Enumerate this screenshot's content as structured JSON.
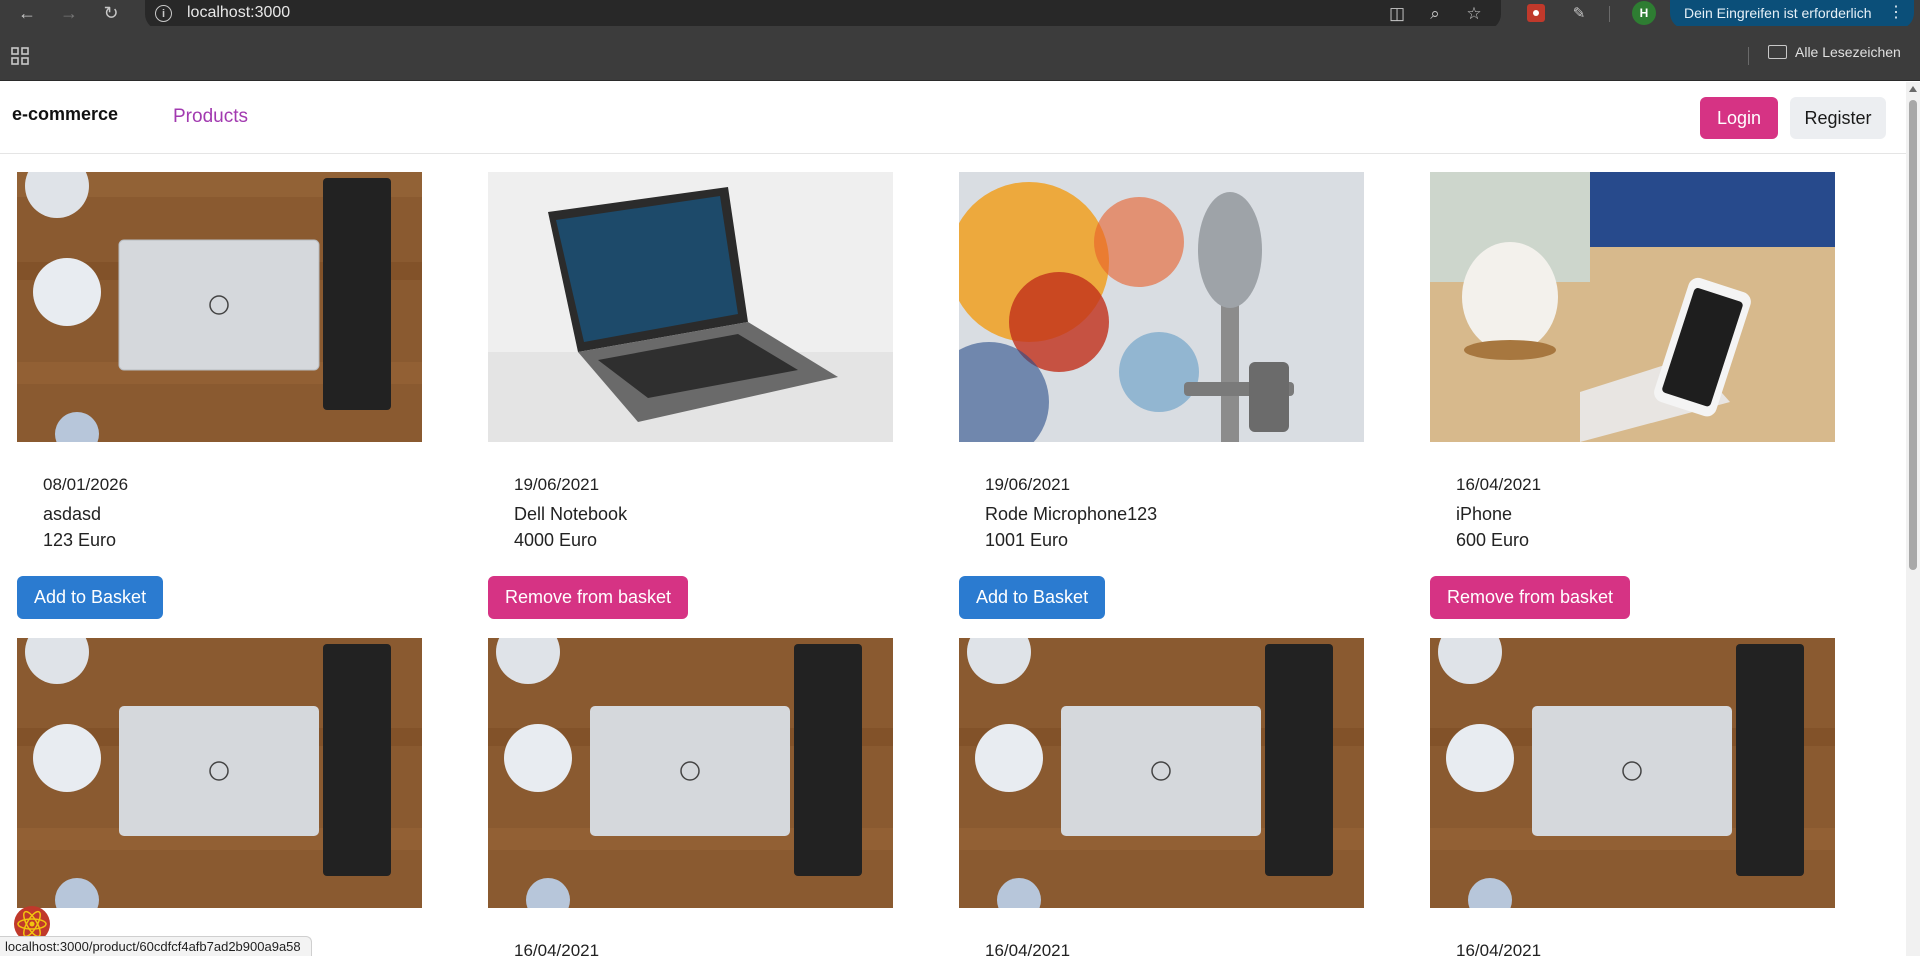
{
  "browser": {
    "url": "localhost:3000",
    "update_notice": "Dein Eingreifen ist erforderlich",
    "profile_initial": "H",
    "bookmarks_all": "Alle Lesezeichen",
    "status_url": "localhost:3000/product/60cdfcf4afb7ad2b900a9a58"
  },
  "navbar": {
    "brand": "e-commerce",
    "products_link": "Products",
    "login": "Login",
    "register": "Register"
  },
  "products": [
    {
      "date": "08/01/2026",
      "name": "asdasd",
      "price": "123 Euro",
      "button": "Add to Basket",
      "button_color": "#2b7bd0",
      "image": "laptop-desk"
    },
    {
      "date": "19/06/2021",
      "name": "Dell Notebook",
      "price": "4000 Euro",
      "button": "Remove from basket",
      "button_color": "#d63384",
      "image": "laptop-open"
    },
    {
      "date": "19/06/2021",
      "name": "Rode Microphone123",
      "price": "1001 Euro",
      "button": "Add to Basket",
      "button_color": "#2b7bd0",
      "image": "microphone"
    },
    {
      "date": "16/04/2021",
      "name": "iPhone",
      "price": "600 Euro",
      "button": "Remove from basket",
      "button_color": "#d63384",
      "image": "phone-hand"
    },
    {
      "date": "",
      "image": "laptop-desk"
    },
    {
      "date": "16/04/2021",
      "image": "laptop-desk"
    },
    {
      "date": "16/04/2021",
      "image": "laptop-desk"
    },
    {
      "date": "16/04/2021",
      "image": "laptop-desk"
    }
  ],
  "colors": {
    "primary_pink": "#d63384",
    "primary_blue": "#2b7bd0",
    "link_purple": "#a23ab0"
  }
}
